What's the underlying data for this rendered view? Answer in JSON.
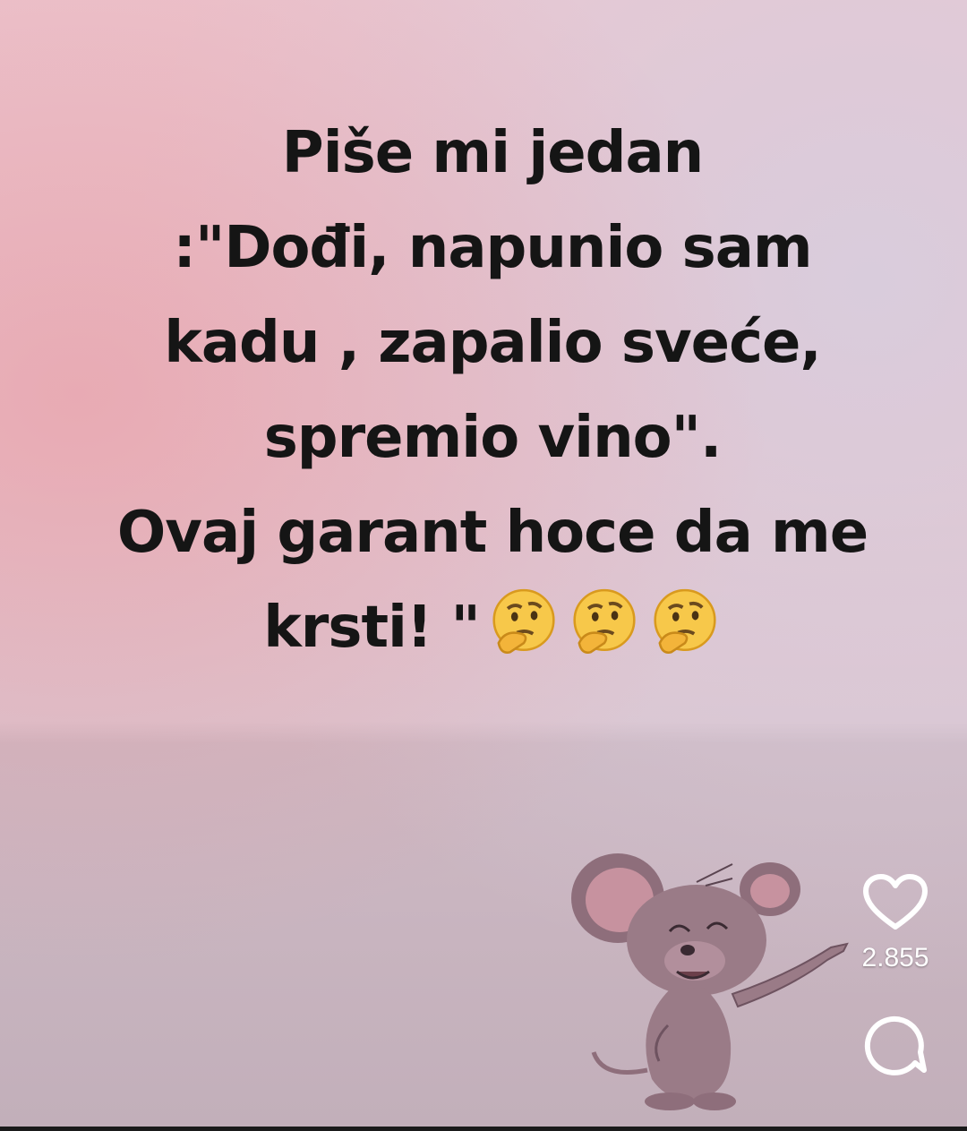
{
  "post": {
    "text_lines": [
      "Piše mi jedan",
      ":\"Dođi, napunio sam",
      "kadu , zapalio sveće,",
      "spremio vino\".",
      "Ovaj garant hoce da me",
      "krsti! \""
    ],
    "emojis": [
      "thinking-face",
      "thinking-face",
      "thinking-face"
    ]
  },
  "actions": {
    "like_icon": "heart-outline-icon",
    "like_count": "2.855",
    "comment_icon": "comment-bubble-icon"
  },
  "colors": {
    "background_top": "#ecc6cf",
    "background_bottom": "#c2afba",
    "text": "#151515",
    "icon": "#ffffff"
  }
}
